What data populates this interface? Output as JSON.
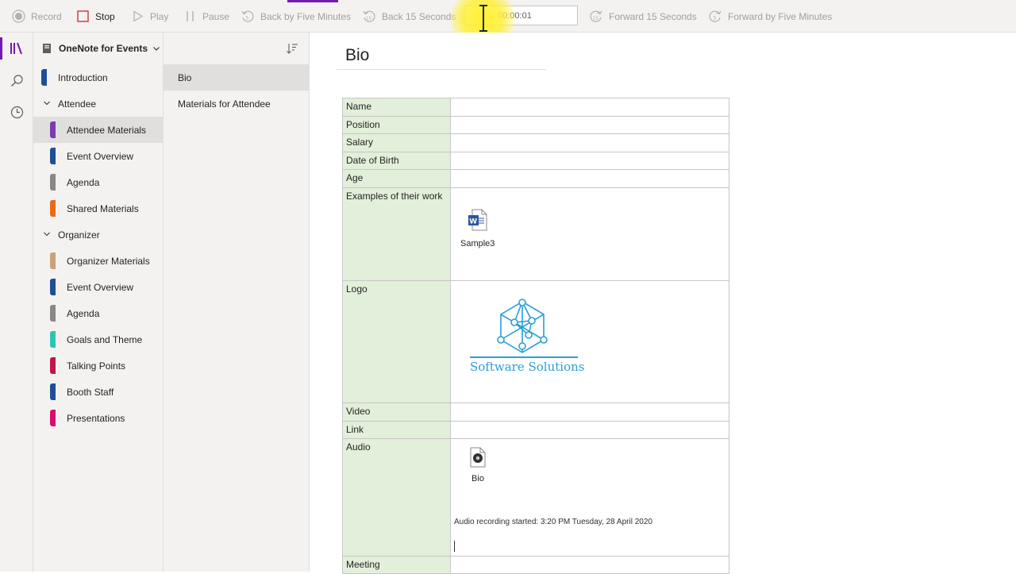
{
  "toolbar": {
    "record": "Record",
    "stop": "Stop",
    "play": "Play",
    "pause": "Pause",
    "back_five": "Back by Five Minutes",
    "back_15": "Back 15 Seconds",
    "time": "00:00:01",
    "forward_15": "Forward 15 Seconds",
    "forward_five": "Forward by Five Minutes"
  },
  "notebook": {
    "name": "OneNote for Events"
  },
  "sections": [
    {
      "label": "Introduction",
      "color": "#1f4e96",
      "indent": 0,
      "type": "section"
    },
    {
      "label": "Attendee",
      "indent": 0,
      "type": "group"
    },
    {
      "label": "Attendee Materials",
      "color": "#7a3db0",
      "indent": 1,
      "type": "section",
      "selected": true
    },
    {
      "label": "Event Overview",
      "color": "#1f4e96",
      "indent": 1,
      "type": "section"
    },
    {
      "label": "Agenda",
      "color": "#8a8886",
      "indent": 1,
      "type": "section"
    },
    {
      "label": "Shared Materials",
      "color": "#ea6a1b",
      "indent": 1,
      "type": "section"
    },
    {
      "label": "Organizer",
      "indent": 0,
      "type": "group"
    },
    {
      "label": "Organizer Materials",
      "color": "#c8a27a",
      "indent": 1,
      "type": "section"
    },
    {
      "label": "Event Overview",
      "color": "#1f4e96",
      "indent": 1,
      "type": "section"
    },
    {
      "label": "Agenda",
      "color": "#8a8886",
      "indent": 1,
      "type": "section"
    },
    {
      "label": "Goals and Theme",
      "color": "#2ec5b0",
      "indent": 1,
      "type": "section"
    },
    {
      "label": "Talking Points",
      "color": "#c0154a",
      "indent": 1,
      "type": "section"
    },
    {
      "label": "Booth Staff",
      "color": "#1f4e96",
      "indent": 1,
      "type": "section"
    },
    {
      "label": "Presentations",
      "color": "#d40f6f",
      "indent": 1,
      "type": "section"
    }
  ],
  "pages": [
    {
      "label": "Bio",
      "selected": true
    },
    {
      "label": "Materials for Attendee"
    }
  ],
  "page": {
    "title": "Bio",
    "rows": [
      {
        "label": "Name"
      },
      {
        "label": "Position"
      },
      {
        "label": "Salary"
      },
      {
        "label": "Date of Birth"
      },
      {
        "label": "Age"
      },
      {
        "label": "Examples of their work"
      },
      {
        "label": "Logo"
      },
      {
        "label": "Video"
      },
      {
        "label": "Link"
      },
      {
        "label": "Audio"
      },
      {
        "label": "Meeting"
      }
    ],
    "word_attachment": "Sample3",
    "logo_text": "Software Solutions",
    "audio_attachment": "Bio",
    "audio_note": "Audio recording started: 3:20 PM Tuesday, 28 April 2020"
  },
  "colors": {
    "accent": "#7719aa",
    "label_cell": "#e2efda",
    "logo_blue": "#2a9fd6"
  }
}
